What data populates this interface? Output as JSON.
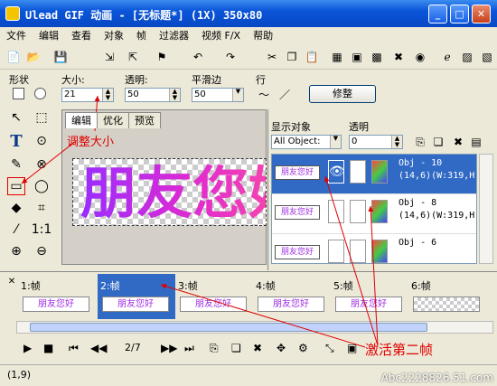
{
  "window": {
    "title": "Ulead GIF 动画 - [无标题*] (1X) 350x80"
  },
  "menu": [
    "文件",
    "编辑",
    "查看",
    "对象",
    "帧",
    "过滤器",
    "视频 F/X",
    "帮助"
  ],
  "props": {
    "shape_label": "形状",
    "size_label": "大小:",
    "size_value": "21",
    "transparency_label": "透明:",
    "transparency_value": "50",
    "smooth_label": "平滑边",
    "smooth_value": "50",
    "row_label": "行",
    "modify_button": "修整"
  },
  "canvas": {
    "tabs": [
      "编辑",
      "优化",
      "预览"
    ],
    "text": "朋友您好",
    "annotation": "调整大小"
  },
  "objects": {
    "header": "显示对象",
    "transparency_label": "透明",
    "filter_value": "All Object:",
    "transparency_value": "0",
    "items": [
      {
        "name": "Obj - 10",
        "info": "(14,6)(W:319,H",
        "thumb": "朋友您好"
      },
      {
        "name": "Obj - 8",
        "info": "(14,6)(W:319,H",
        "thumb": "朋友您好"
      },
      {
        "name": "Obj - 6",
        "info": "",
        "thumb": "朋友您好"
      }
    ]
  },
  "frames": {
    "items": [
      {
        "label": "1:帧",
        "thumb": "朋友您好"
      },
      {
        "label": "2:帧",
        "thumb": "朋友您好"
      },
      {
        "label": "3:帧",
        "thumb": "朋友您好"
      },
      {
        "label": "4:帧",
        "thumb": "朋友您好"
      },
      {
        "label": "5:帧",
        "thumb": "朋友您好"
      },
      {
        "label": "6:帧",
        "thumb": ""
      }
    ],
    "selected_index": 1
  },
  "playback": {
    "counter": "2/7",
    "annotation": "激活第二帧"
  },
  "status": {
    "coords": "(1,9)",
    "watermark": "Abc2228826.51.com"
  }
}
